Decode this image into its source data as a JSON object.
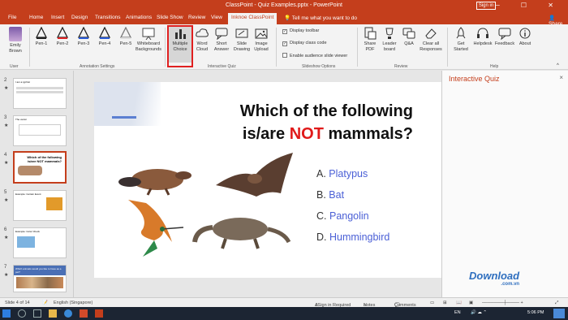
{
  "titlebar": {
    "title": "ClassPoint - Quiz Examples.pptx - PowerPoint",
    "signin": "Sign in"
  },
  "tabs": [
    "File",
    "Home",
    "Insert",
    "Design",
    "Transitions",
    "Animations",
    "Slide Show",
    "Review",
    "View",
    "Inknoe ClassPoint"
  ],
  "tell_me": "Tell me what you want to do",
  "share": "Share",
  "ribbon": {
    "user": {
      "name1": "Emily",
      "name2": "Brown",
      "group": "User"
    },
    "pens": [
      "Pen-1",
      "Pen-2",
      "Pen-3",
      "Pen-4",
      "Pen-5"
    ],
    "whiteboard1": "Whiteboard",
    "whiteboard2": "Backgrounds",
    "annotation_group": "Annotation Settings",
    "quiz": [
      {
        "l1": "Multiple",
        "l2": "Choice"
      },
      {
        "l1": "Word",
        "l2": "Cloud"
      },
      {
        "l1": "Short",
        "l2": "Answer"
      },
      {
        "l1": "Slide",
        "l2": "Drawing"
      },
      {
        "l1": "Image",
        "l2": "Upload"
      }
    ],
    "quiz_group": "Interactive Quiz",
    "options": [
      "Display toolbar",
      "Display class code",
      "Enable audience slide viewer"
    ],
    "options_group": "Slideshow Options",
    "review": [
      {
        "l1": "Share",
        "l2": "PDF"
      },
      {
        "l1": "Leader",
        "l2": "board"
      },
      {
        "l1": "Q&A",
        "l2": ""
      },
      {
        "l1": "Clear all",
        "l2": "Responses"
      }
    ],
    "review_group": "Review",
    "help": [
      {
        "l1": "Get",
        "l2": "Started"
      },
      {
        "l1": "Helpdesk",
        "l2": ""
      },
      {
        "l1": "Feedback",
        "l2": ""
      },
      {
        "l1": "About",
        "l2": ""
      }
    ],
    "help_group": "Help"
  },
  "thumbs": [
    {
      "num": "2",
      "text": "I am a typhist"
    },
    {
      "num": "3",
      "text": "The vector"
    },
    {
      "num": "4",
      "text": "Which of the following is/are NOT mammals?"
    },
    {
      "num": "5",
      "text": "Example: Certain Event"
    },
    {
      "num": "6",
      "text": "Example: Color Check"
    },
    {
      "num": "7",
      "text": "Which animals would you like to have as a pet?"
    }
  ],
  "slide": {
    "q1": "Which of the following",
    "q2a": "is/are ",
    "q2b": "NOT",
    "q2c": " mammals?",
    "answers": [
      {
        "letter": "A.",
        "text": "Platypus"
      },
      {
        "letter": "B.",
        "text": "Bat"
      },
      {
        "letter": "C.",
        "text": "Pangolin"
      },
      {
        "letter": "D.",
        "text": "Hummingbird"
      }
    ]
  },
  "panel": {
    "title": "Interactive Quiz",
    "close": "×"
  },
  "status": {
    "slide": "Slide 4 of 14",
    "lang": "English (Singapore)",
    "signin": "&Sign in Required",
    "notes": "Notes",
    "comments": "Comments"
  },
  "taskbar": {
    "lang": "EN",
    "time": "5:06 PM"
  },
  "watermark": {
    "text": "Download",
    "suffix": ".com.vn"
  },
  "colors": {
    "accent": "#c43e1c",
    "answer": "#4a5fd6",
    "not": "#e01a1a"
  }
}
